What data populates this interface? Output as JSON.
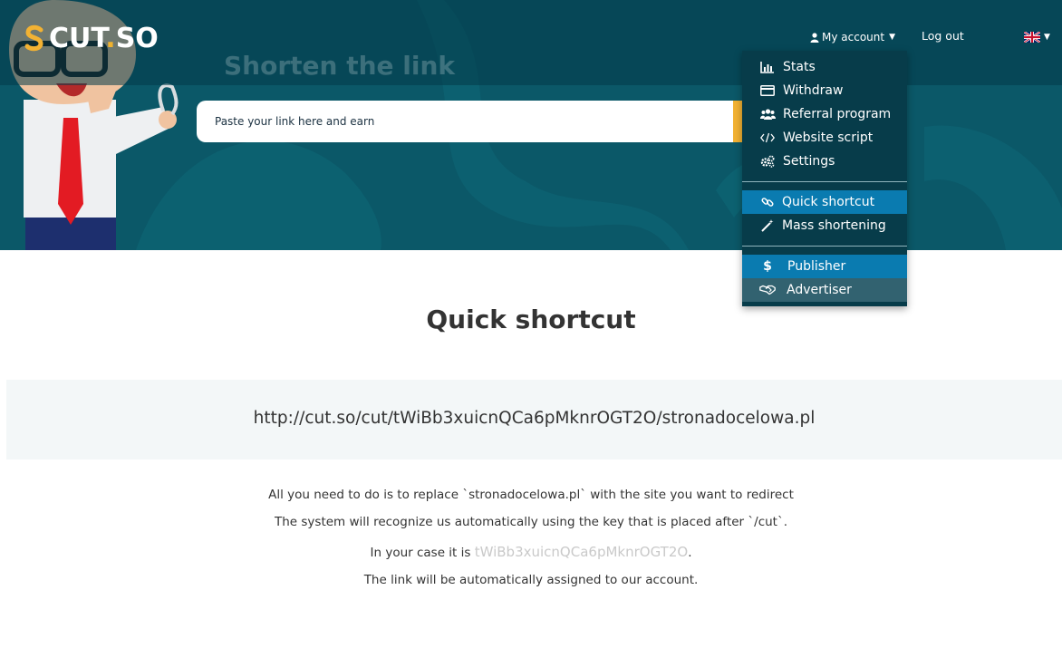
{
  "header": {
    "logo_text": "CUT",
    "logo_dot": ".",
    "logo_suffix": "SO",
    "nav": {
      "account_label": "My account",
      "logout_label": "Log out"
    },
    "language_flag": "uk-flag-icon"
  },
  "hero": {
    "title": "Shorten the link",
    "search": {
      "placeholder": "Paste your link here and earn",
      "value": ""
    },
    "button_label": ""
  },
  "account_menu": {
    "items": [
      {
        "label": "Stats",
        "icon": "stats-icon"
      },
      {
        "label": "Withdraw",
        "icon": "credit-card-icon"
      },
      {
        "label": "Referral program",
        "icon": "users-icon"
      },
      {
        "label": "Website script",
        "icon": "code-icon"
      },
      {
        "label": "Settings",
        "icon": "gears-icon"
      },
      {
        "label": "Quick shortcut",
        "icon": "link-icon",
        "active": true
      },
      {
        "label": "Mass shortening",
        "icon": "magic-wand-icon"
      },
      {
        "label": "Publisher",
        "icon": "dollar-icon",
        "active": true
      },
      {
        "label": "Advertiser",
        "icon": "handshake-icon"
      }
    ]
  },
  "main": {
    "title": "Quick shortcut",
    "url": "http://cut.so/cut/tWiBb3xuicnQCa6pMknrOGT2O/stronadocelowa.pl",
    "info_lines": [
      "All you need to do is to replace `stronadocelowa.pl` with the site you want to redirect",
      "The system will recognize us automatically using the key that is placed after `/cut`.",
      "The link will be automatically assigned to our account."
    ],
    "key_prefix": "In your case it is ",
    "key": "tWiBb3xuicnQCa6pMknrOGT2O",
    "key_suffix": "."
  },
  "colors": {
    "hero_bg": "#0b5868",
    "accent_yellow": "#f2b233",
    "menu_bg": "#073c4a",
    "menu_active": "#0a7bb0",
    "menu_advertiser": "#326270",
    "url_panel_bg": "#f3f7f8",
    "key_color": "#c9c9c9"
  }
}
